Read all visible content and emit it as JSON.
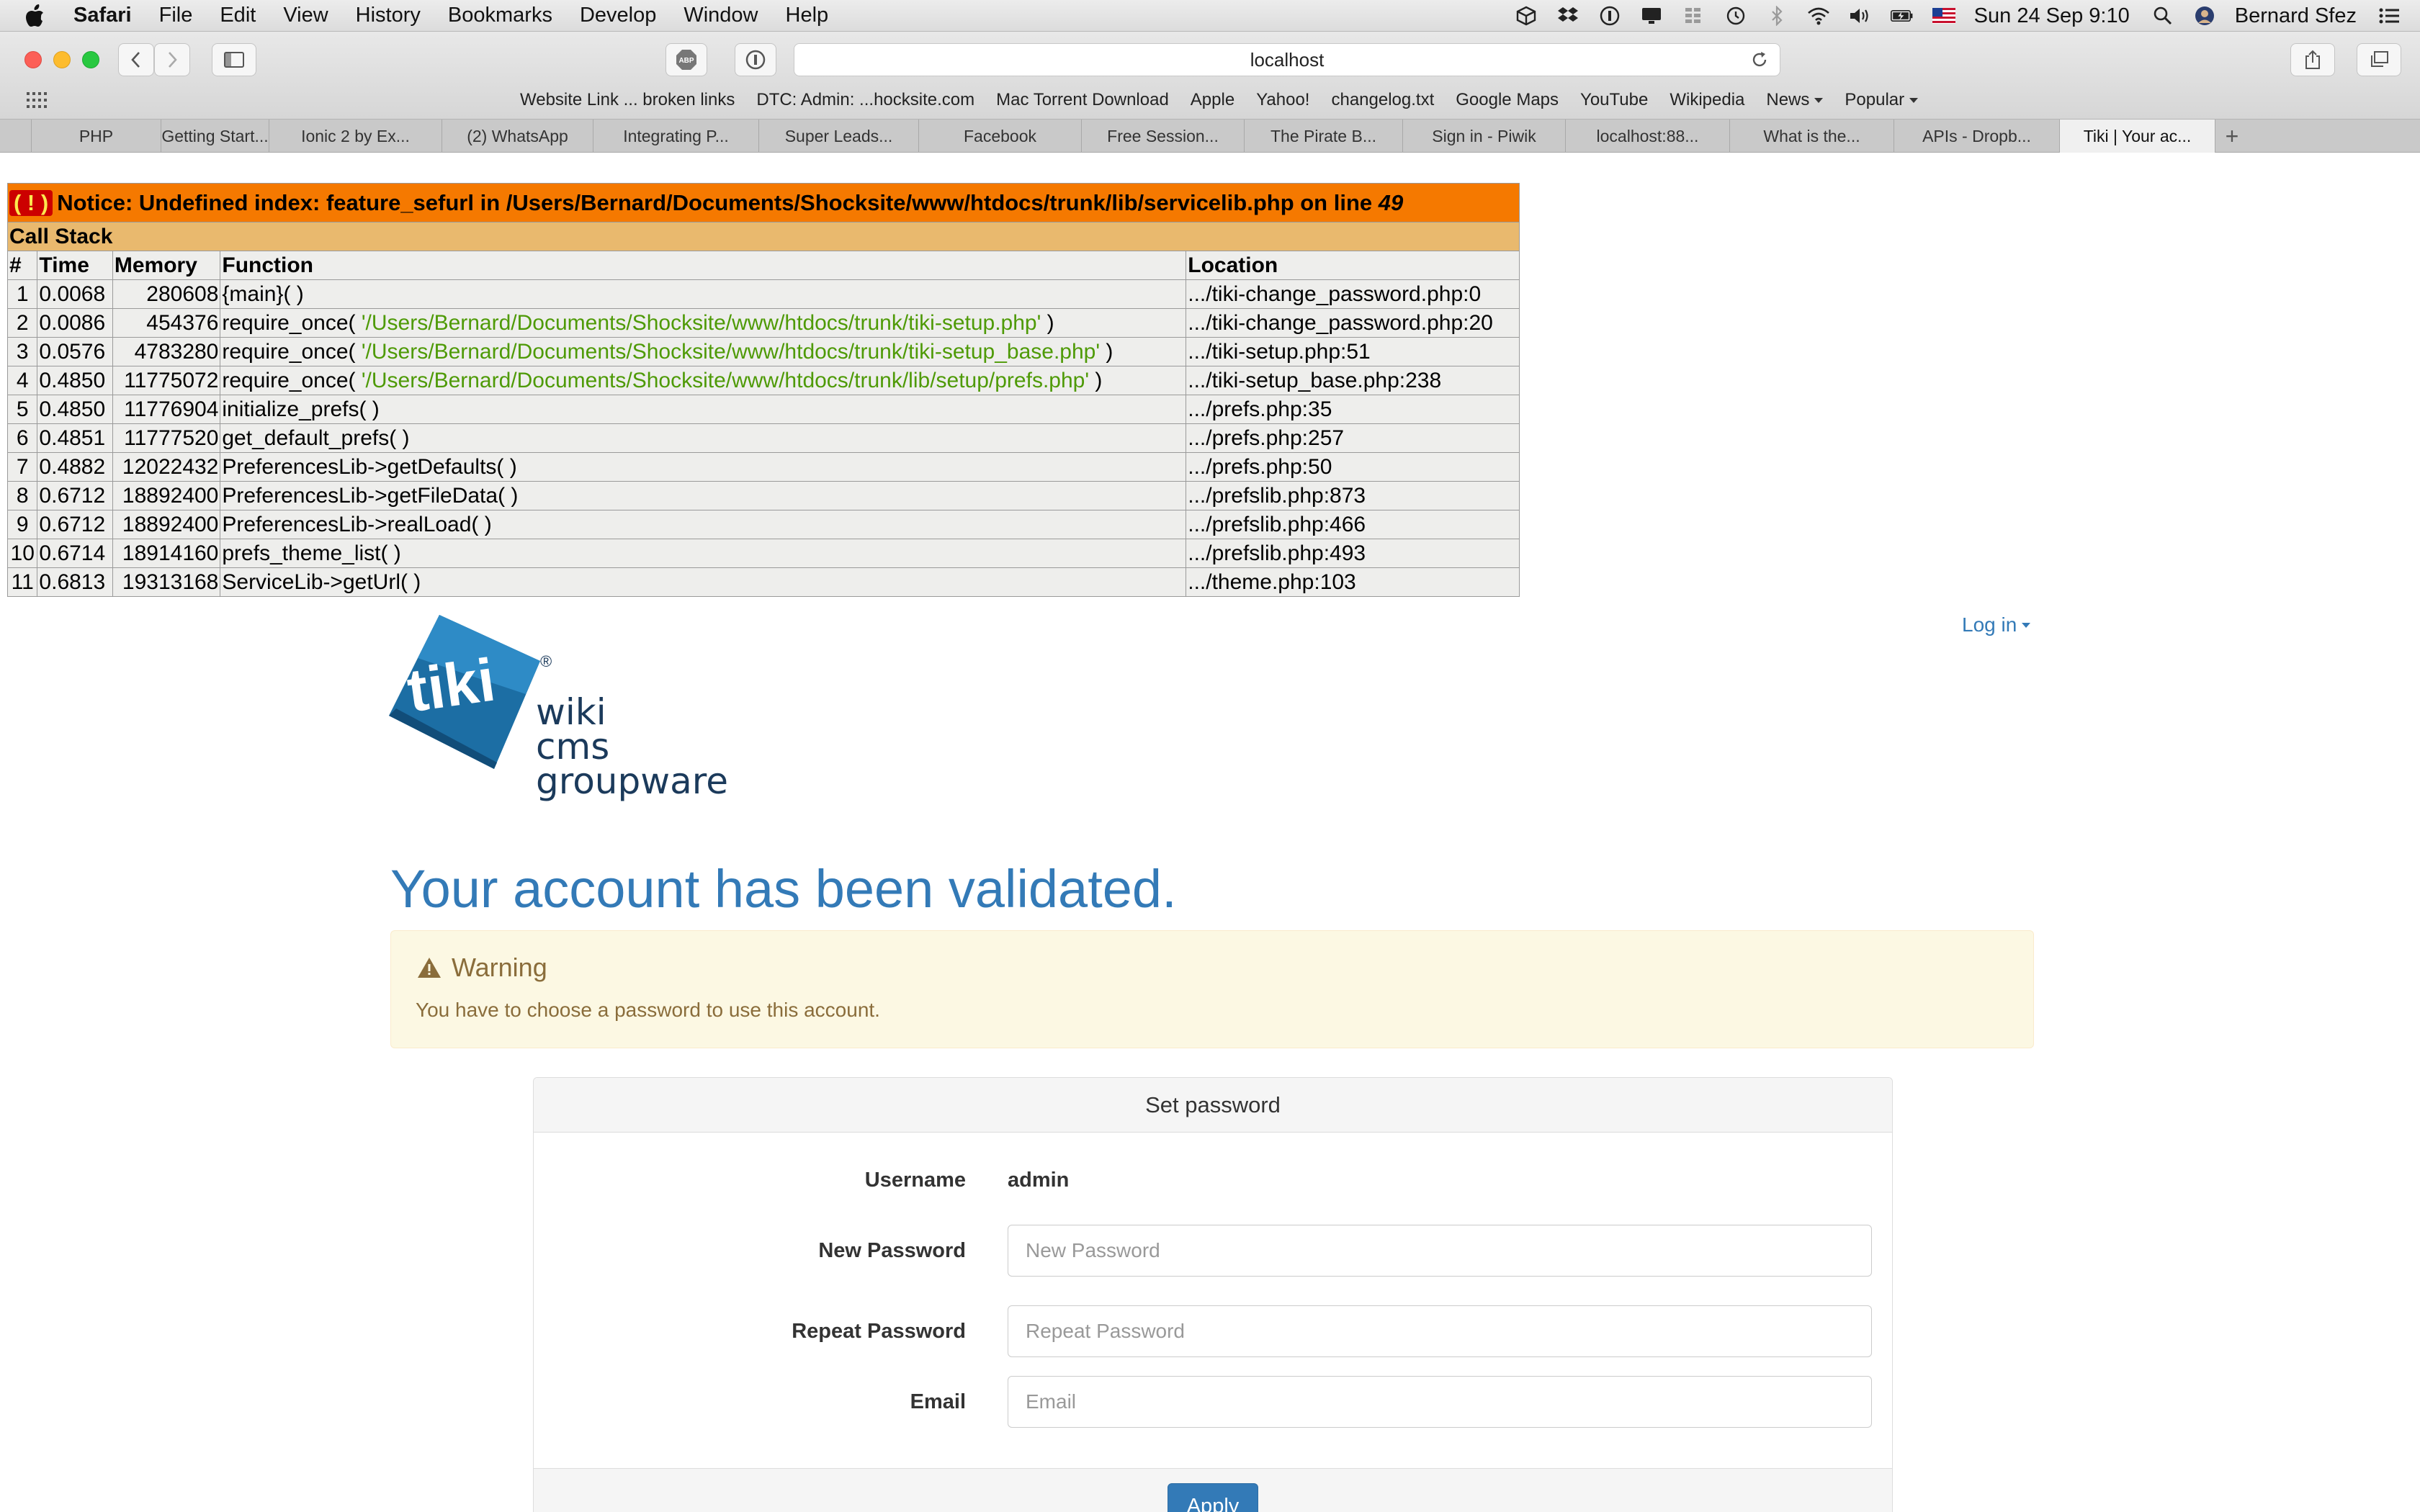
{
  "menubar": {
    "items": [
      "Safari",
      "File",
      "Edit",
      "View",
      "History",
      "Bookmarks",
      "Develop",
      "Window",
      "Help"
    ],
    "datetime": "Sun 24 Sep  9:10",
    "user": "Bernard Sfez"
  },
  "toolbar": {
    "url": "localhost"
  },
  "favorites": [
    {
      "label": "Website Link ... broken links",
      "dropdown": false
    },
    {
      "label": "DTC: Admin: ...hocksite.com",
      "dropdown": false
    },
    {
      "label": "Mac Torrent Download",
      "dropdown": false
    },
    {
      "label": "Apple",
      "dropdown": false
    },
    {
      "label": "Yahoo!",
      "dropdown": false
    },
    {
      "label": "changelog.txt",
      "dropdown": false
    },
    {
      "label": "Google Maps",
      "dropdown": false
    },
    {
      "label": "YouTube",
      "dropdown": false
    },
    {
      "label": "Wikipedia",
      "dropdown": false
    },
    {
      "label": "News",
      "dropdown": true
    },
    {
      "label": "Popular",
      "dropdown": true
    }
  ],
  "tabs": [
    "",
    "PHP",
    "Getting Start...",
    "Ionic 2 by Ex...",
    "(2) WhatsApp",
    "Integrating P...",
    "Super Leads...",
    "Facebook",
    "Free Session...",
    "The Pirate B...",
    "Sign in - Piwik",
    "localhost:88...",
    "What is the...",
    "APIs - Dropb...",
    "Tiki | Your ac..."
  ],
  "active_tab_index": 14,
  "xdebug": {
    "bang": "( ! )",
    "notice_prefix": "Notice: Undefined index: feature_sefurl in /Users/Bernard/Documents/Shocksite/www/htdocs/trunk/lib/servicelib.php on line ",
    "notice_line": "49",
    "call_stack_label": "Call Stack",
    "headers": [
      "#",
      "Time",
      "Memory",
      "Function",
      "Location"
    ],
    "rows": [
      {
        "n": "1",
        "time": "0.0068",
        "memory": "280608",
        "fn": "{main}( )",
        "arg": "",
        "fn_close": "",
        "loc": ".../tiki-change_password.php:0"
      },
      {
        "n": "2",
        "time": "0.0086",
        "memory": "454376",
        "fn": "require_once( ",
        "arg": "'/Users/Bernard/Documents/Shocksite/www/htdocs/trunk/tiki-setup.php'",
        "fn_close": " )",
        "loc": ".../tiki-change_password.php:20"
      },
      {
        "n": "3",
        "time": "0.0576",
        "memory": "4783280",
        "fn": "require_once( ",
        "arg": "'/Users/Bernard/Documents/Shocksite/www/htdocs/trunk/tiki-setup_base.php'",
        "fn_close": " )",
        "loc": ".../tiki-setup.php:51"
      },
      {
        "n": "4",
        "time": "0.4850",
        "memory": "11775072",
        "fn": "require_once( ",
        "arg": "'/Users/Bernard/Documents/Shocksite/www/htdocs/trunk/lib/setup/prefs.php'",
        "fn_close": " )",
        "loc": ".../tiki-setup_base.php:238"
      },
      {
        "n": "5",
        "time": "0.4850",
        "memory": "11776904",
        "fn": "initialize_prefs( )",
        "arg": "",
        "fn_close": "",
        "loc": ".../prefs.php:35"
      },
      {
        "n": "6",
        "time": "0.4851",
        "memory": "11777520",
        "fn": "get_default_prefs( )",
        "arg": "",
        "fn_close": "",
        "loc": ".../prefs.php:257"
      },
      {
        "n": "7",
        "time": "0.4882",
        "memory": "12022432",
        "fn": "PreferencesLib->getDefaults( )",
        "arg": "",
        "fn_close": "",
        "loc": ".../prefs.php:50"
      },
      {
        "n": "8",
        "time": "0.6712",
        "memory": "18892400",
        "fn": "PreferencesLib->getFileData( )",
        "arg": "",
        "fn_close": "",
        "loc": ".../prefslib.php:873"
      },
      {
        "n": "9",
        "time": "0.6712",
        "memory": "18892400",
        "fn": "PreferencesLib->realLoad( )",
        "arg": "",
        "fn_close": "",
        "loc": ".../prefslib.php:466"
      },
      {
        "n": "10",
        "time": "0.6714",
        "memory": "18914160",
        "fn": "prefs_theme_list( )",
        "arg": "",
        "fn_close": "",
        "loc": ".../prefslib.php:493"
      },
      {
        "n": "11",
        "time": "0.6813",
        "memory": "19313168",
        "fn": "ServiceLib->getUrl( )",
        "arg": "",
        "fn_close": "",
        "loc": ".../theme.php:103"
      }
    ]
  },
  "header": {
    "login_label": "Log in"
  },
  "logo": {
    "brand": "tiki",
    "registered": "®",
    "line1": "wiki",
    "line2": "cms",
    "line3": "groupware"
  },
  "page": {
    "title": "Your account has been validated."
  },
  "alert": {
    "title": "Warning",
    "text": "You have to choose a password to use this account."
  },
  "form": {
    "heading": "Set password",
    "username_label": "Username",
    "username_value": "admin",
    "new_password_label": "New Password",
    "new_password_placeholder": "New Password",
    "repeat_password_label": "Repeat Password",
    "repeat_password_placeholder": "Repeat Password",
    "email_label": "Email",
    "email_placeholder": "Email",
    "apply_label": "Apply"
  },
  "colors": {
    "link": "#337ab7",
    "notice_orange": "#f57900",
    "callstack_tan": "#e9b96e",
    "warning_bg": "#fcf8e3",
    "warning_text": "#8a6d3b",
    "arg_green": "#4e9a06"
  }
}
